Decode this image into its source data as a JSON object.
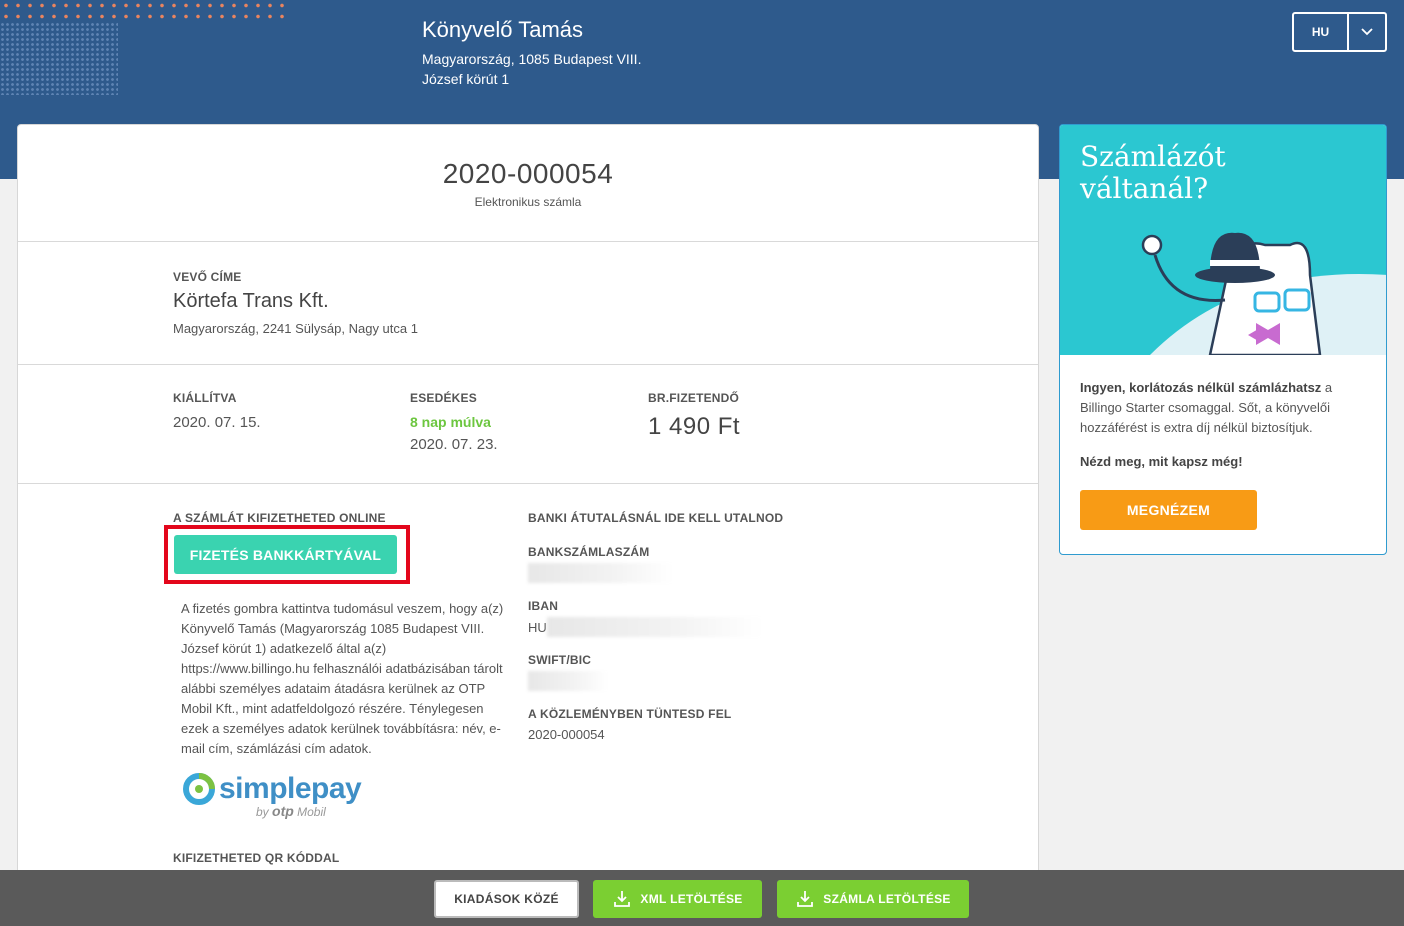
{
  "header": {
    "company_name": "Könyvelő Tamás",
    "address_line1": "Magyarország, 1085 Budapest VIII.",
    "address_line2": "József körút 1",
    "language": "HU"
  },
  "invoice": {
    "number": "2020-000054",
    "type_label": "Elektronikus számla"
  },
  "buyer": {
    "label": "VEVŐ CÍME",
    "name": "Körtefa Trans Kft.",
    "address": "Magyarország, 2241 Sülysáp, Nagy utca 1"
  },
  "dates": {
    "issued_label": "KIÁLLÍTVA",
    "issued_value": "2020. 07. 15.",
    "due_label": "ESEDÉKES",
    "due_relative": "8 nap múlva",
    "due_value": "2020. 07. 23.",
    "amount_label": "BR.FIZETENDŐ",
    "amount_value": "1 490 Ft"
  },
  "payment": {
    "online_label": "A SZÁMLÁT KIFIZETHETED ONLINE",
    "card_button": "FIZETÉS BANKKÁRTYÁVAL",
    "consent_text": "A fizetés gombra kattintva tudomásul veszem, hogy a(z) Könyvelő Tamás (Magyarország 1085 Budapest VIII. József körút 1) adatkezelő által a(z) https://www.billingo.hu felhasználói adatbázisában tárolt alábbi személyes adataim átadásra kerülnek az OTP Mobil Kft., mint adatfeldolgozó részére. Ténylegesen ezek a személyes adatok kerülnek továbbításra: név, e-mail cím, számlázási cím adatok.",
    "simplepay_word": "simplepay",
    "simplepay_by": "by",
    "simplepay_brand": "otp",
    "simplepay_mobil": "Mobil",
    "qr_label": "KIFIZETHETED QR KÓDDAL"
  },
  "bank": {
    "heading": "BANKI ÁTUTALÁSNÁL IDE KELL UTALNOD",
    "account_label": "BANKSZÁMLASZÁM",
    "iban_label": "IBAN",
    "iban_prefix": "HU",
    "swift_label": "SWIFT/BIC",
    "reference_label": "A KÖZLEMÉNYBEN TÜNTESD FEL",
    "reference_value": "2020-000054"
  },
  "promo": {
    "title_line1": "Számlázót",
    "title_line2": "váltanál?",
    "body_bold": "Ingyen, korlátozás nélkül számlázhatsz",
    "body_rest": " a Billingo Starter csomaggal. Sőt, a könyvelői hozzáférést is extra díj nélkül biztosítjuk.",
    "ask": "Nézd meg, mit kapsz még!",
    "cta": "MEGNÉZEM"
  },
  "footer": {
    "expenses_button": "KIADÁSOK KÖZÉ",
    "xml_button": "XML LETÖLTÉSE",
    "invoice_button": "SZÁMLA LETÖLTÉSE"
  },
  "colors": {
    "header_bg": "#2e5a8c",
    "pay_button": "#3ad3b0",
    "highlight": "#e3061b",
    "promo_bg": "#2bc7d1",
    "cta": "#f89b15",
    "download_green": "#7bcf32"
  }
}
